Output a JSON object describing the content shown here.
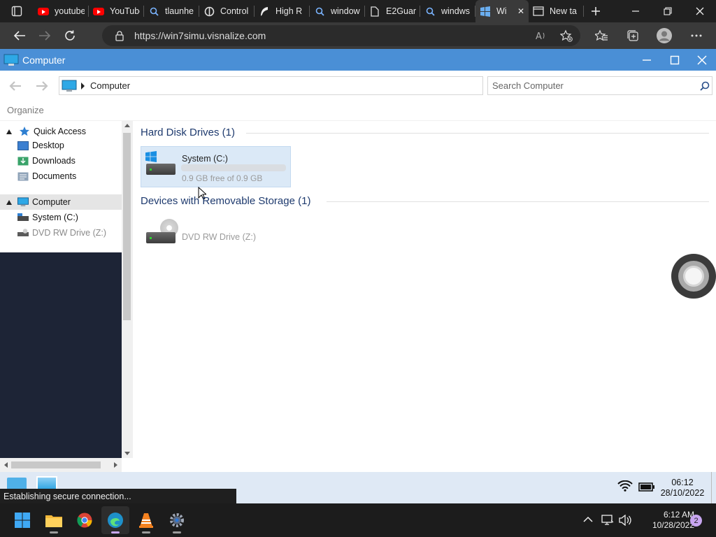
{
  "browser": {
    "tabs": [
      {
        "label": "youtube",
        "icon": "youtube-icon"
      },
      {
        "label": "YouTube",
        "icon": "youtube-icon"
      },
      {
        "label": "tlaunhe",
        "icon": "search-icon"
      },
      {
        "label": "Control",
        "icon": "control-icon"
      },
      {
        "label": "High R",
        "icon": "feather-icon"
      },
      {
        "label": "window",
        "icon": "search-icon"
      },
      {
        "label": "E2Guar",
        "icon": "page-icon"
      },
      {
        "label": "windws",
        "icon": "search-icon"
      },
      {
        "label": "Wi",
        "icon": "windows7-icon",
        "active": true
      },
      {
        "label": "New ta",
        "icon": "newtab-icon"
      }
    ],
    "url": "https://win7simu.visnalize.com",
    "accent": "#202020"
  },
  "window": {
    "title": "Computer",
    "address_crumb": "Computer",
    "search_placeholder": "Search Computer",
    "toolbar_organize": "Organize",
    "titlebar_color": "#4a8fd6"
  },
  "nav_pane": {
    "quick_access": "Quick Access",
    "desktop": "Desktop",
    "downloads": "Downloads",
    "documents": "Documents",
    "computer": "Computer",
    "system_c": "System (C:)",
    "dvd": "DVD RW Drive (Z:)"
  },
  "content": {
    "hdd_group": "Hard Disk Drives (1)",
    "removable_group": "Devices with Removable Storage (1)",
    "drive_c": {
      "name": "System (C:)",
      "free": "0.9 GB free of 0.9 GB",
      "used_fraction": 0.0
    },
    "dvd": {
      "name": "DVD RW Drive (Z:)"
    }
  },
  "win7_taskbar": {
    "status": "Establishing secure connection...",
    "time": "06:12",
    "date": "28/10/2022"
  },
  "host_taskbar": {
    "time": "6:12 AM",
    "date": "10/28/2022",
    "badge": "2"
  }
}
